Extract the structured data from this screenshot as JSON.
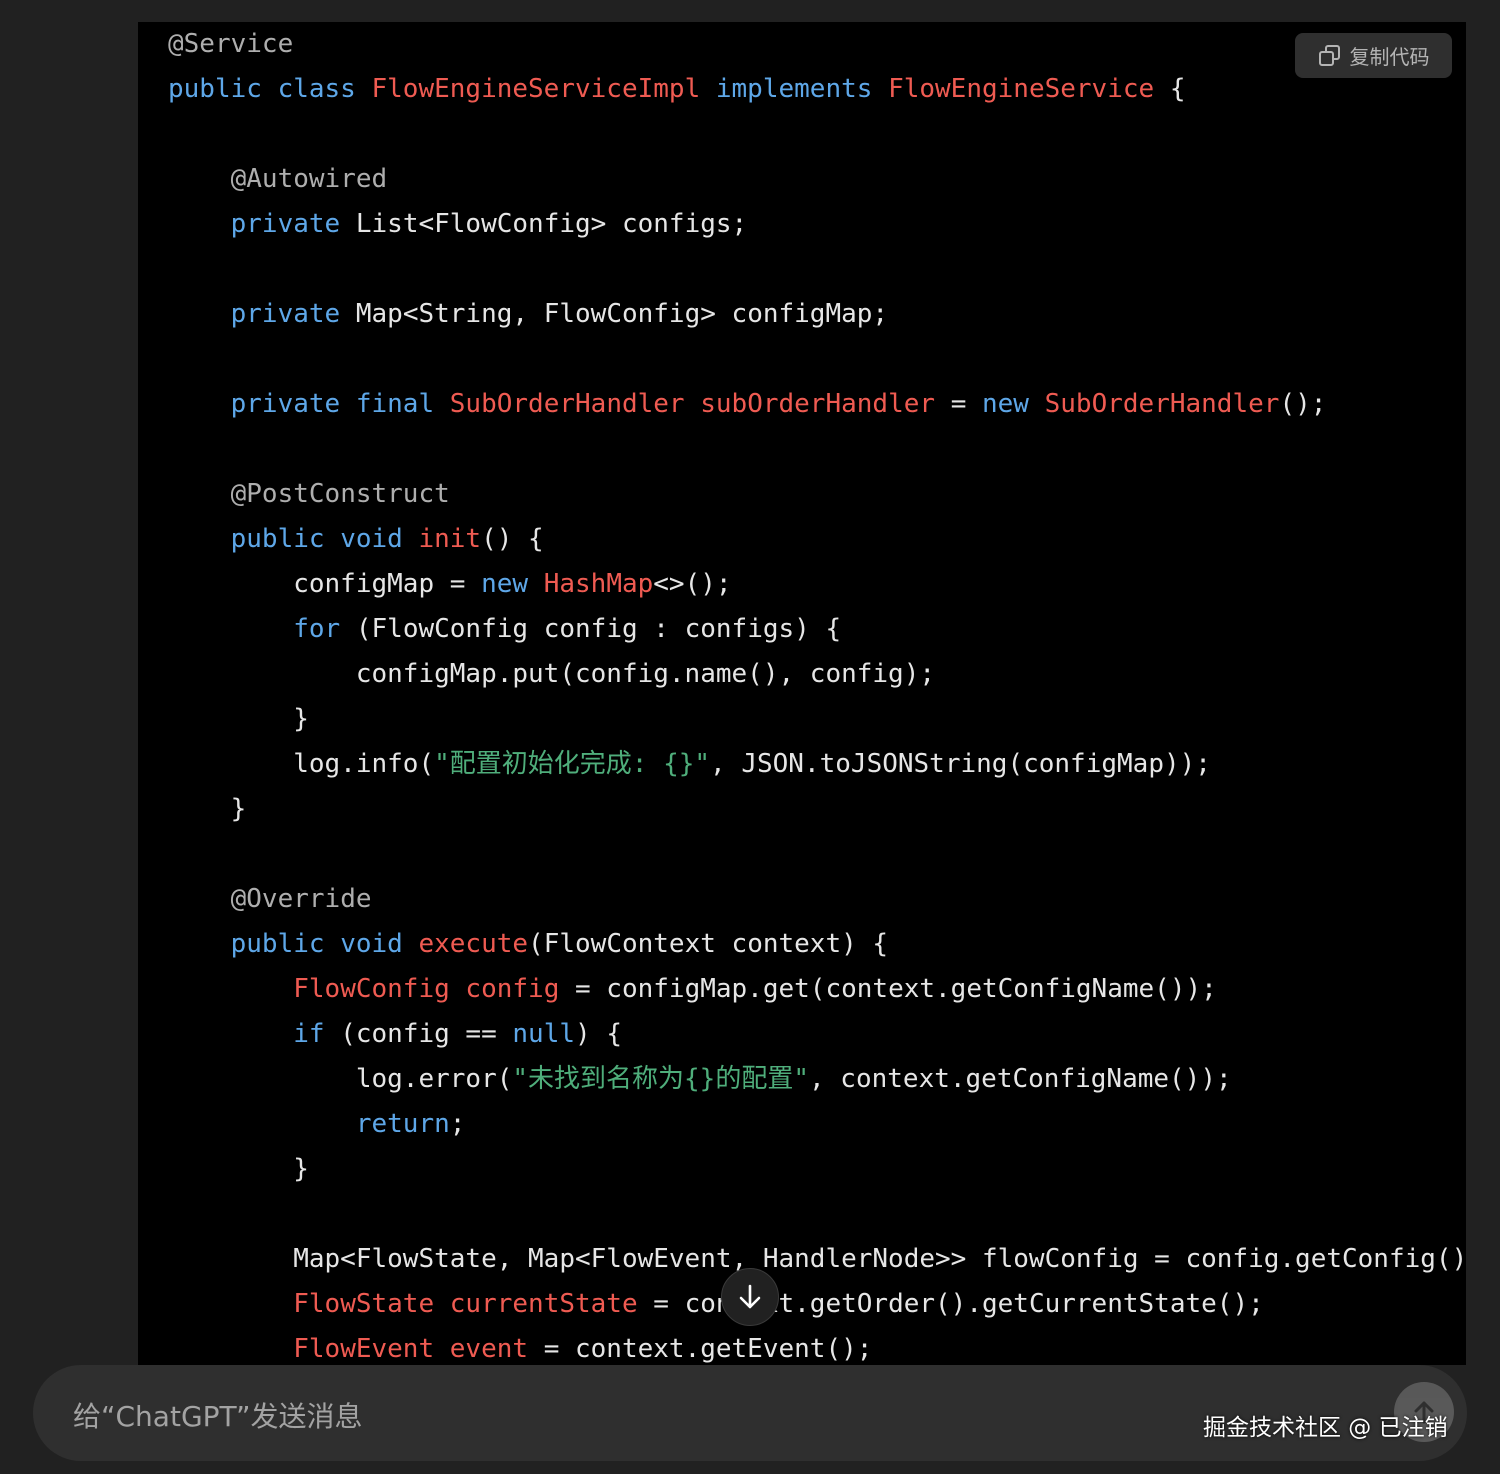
{
  "code_block": {
    "copy_button_label": "复制代码",
    "copy_icon": "copy-icon",
    "lines": [
      [
        [
          "an",
          "@Service"
        ]
      ],
      [
        [
          "kw",
          "public class "
        ],
        [
          "ty",
          "FlowEngineServiceImpl "
        ],
        [
          "kw",
          "implements "
        ],
        [
          "ty",
          "FlowEngineService "
        ],
        [
          "p",
          "{"
        ]
      ],
      [],
      [
        [
          "p",
          "    "
        ],
        [
          "an",
          "@Autowired"
        ]
      ],
      [
        [
          "p",
          "    "
        ],
        [
          "kw",
          "private "
        ],
        [
          "p",
          "List<FlowConfig> configs;"
        ]
      ],
      [],
      [
        [
          "p",
          "    "
        ],
        [
          "kw",
          "private "
        ],
        [
          "p",
          "Map<String, FlowConfig> configMap;"
        ]
      ],
      [],
      [
        [
          "p",
          "    "
        ],
        [
          "kw",
          "private final "
        ],
        [
          "ty",
          "SubOrderHandler subOrderHandler "
        ],
        [
          "p",
          "= "
        ],
        [
          "kw",
          "new "
        ],
        [
          "ty",
          "SubOrderHandler"
        ],
        [
          "p",
          "();"
        ]
      ],
      [],
      [
        [
          "p",
          "    "
        ],
        [
          "an",
          "@PostConstruct"
        ]
      ],
      [
        [
          "p",
          "    "
        ],
        [
          "kw",
          "public void "
        ],
        [
          "ty",
          "init"
        ],
        [
          "p",
          "() {"
        ]
      ],
      [
        [
          "p",
          "        configMap = "
        ],
        [
          "kw",
          "new "
        ],
        [
          "ty",
          "HashMap"
        ],
        [
          "p",
          "<>();"
        ]
      ],
      [
        [
          "p",
          "        "
        ],
        [
          "kw",
          "for "
        ],
        [
          "p",
          "(FlowConfig config : configs) {"
        ]
      ],
      [
        [
          "p",
          "            configMap.put(config.name(), config);"
        ]
      ],
      [
        [
          "p",
          "        }"
        ]
      ],
      [
        [
          "p",
          "        log.info("
        ],
        [
          "st",
          "\"配置初始化完成: {}\""
        ],
        [
          "p",
          ", JSON.toJSONString(configMap));"
        ]
      ],
      [
        [
          "p",
          "    }"
        ]
      ],
      [],
      [
        [
          "p",
          "    "
        ],
        [
          "an",
          "@Override"
        ]
      ],
      [
        [
          "p",
          "    "
        ],
        [
          "kw",
          "public void "
        ],
        [
          "ty",
          "execute"
        ],
        [
          "p",
          "(FlowContext context) {"
        ]
      ],
      [
        [
          "p",
          "        "
        ],
        [
          "ty",
          "FlowConfig config "
        ],
        [
          "p",
          "= configMap.get(context.getConfigName());"
        ]
      ],
      [
        [
          "p",
          "        "
        ],
        [
          "kw",
          "if "
        ],
        [
          "p",
          "(config == "
        ],
        [
          "kw",
          "null"
        ],
        [
          "p",
          ") {"
        ]
      ],
      [
        [
          "p",
          "            log.error("
        ],
        [
          "st",
          "\"未找到名称为{}的配置\""
        ],
        [
          "p",
          ", context.getConfigName());"
        ]
      ],
      [
        [
          "p",
          "            "
        ],
        [
          "kw",
          "return"
        ],
        [
          "p",
          ";"
        ]
      ],
      [
        [
          "p",
          "        }"
        ]
      ],
      [],
      [
        [
          "p",
          "        Map<FlowState, Map<FlowEvent, HandlerNode>> flowConfig = config.getConfig();"
        ]
      ],
      [
        [
          "p",
          "        "
        ],
        [
          "ty",
          "FlowState currentState "
        ],
        [
          "p",
          "= context.getOrder().getCurrentState();"
        ]
      ],
      [
        [
          "p",
          "        "
        ],
        [
          "ty",
          "FlowEvent event "
        ],
        [
          "p",
          "= context.getEvent();"
        ]
      ]
    ]
  },
  "scroll_down_icon": "arrow-down-icon",
  "composer": {
    "placeholder": "给“ChatGPT”发送消息",
    "send_icon": "arrow-up-icon"
  },
  "watermark": "掘金技术社区 @ 已注销"
}
